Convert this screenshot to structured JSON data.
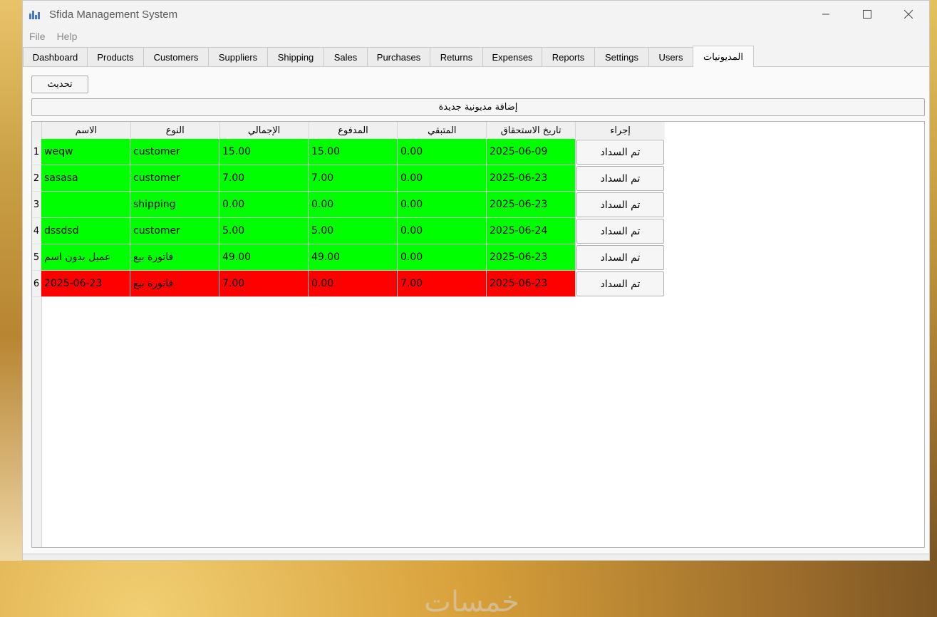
{
  "window": {
    "title": "Sfida Management System"
  },
  "menu": [
    "File",
    "Help"
  ],
  "tabs": [
    {
      "label": "Dashboard"
    },
    {
      "label": "Products"
    },
    {
      "label": "Customers"
    },
    {
      "label": "Suppliers"
    },
    {
      "label": "Shipping"
    },
    {
      "label": "Sales"
    },
    {
      "label": "Purchases"
    },
    {
      "label": "Returns"
    },
    {
      "label": "Expenses"
    },
    {
      "label": "Reports"
    },
    {
      "label": "Settings"
    },
    {
      "label": "Users"
    },
    {
      "label": "المديونيات",
      "active": true
    }
  ],
  "toolbar": {
    "refresh_label": "تحديث",
    "add_label": "إضافة مديونية جديدة"
  },
  "table": {
    "headers": [
      "الاسم",
      "النوع",
      "الإجمالي",
      "المدفوع",
      "المتبقي",
      "تاريخ الاستحقاق",
      "إجراء"
    ],
    "action_label": "تم السداد",
    "row_colors": {
      "paid": "#00ff00",
      "unpaid": "#ff0000"
    },
    "rows": [
      {
        "num": "1",
        "name": "weqw",
        "type": "customer",
        "total": "15.00",
        "paid": "15.00",
        "remaining": "0.00",
        "due": "2025-06-09",
        "status": "paid"
      },
      {
        "num": "2",
        "name": "sasasa",
        "type": "customer",
        "total": "7.00",
        "paid": "7.00",
        "remaining": "0.00",
        "due": "2025-06-23",
        "status": "paid"
      },
      {
        "num": "3",
        "name": "",
        "type": "shipping",
        "total": "0.00",
        "paid": "0.00",
        "remaining": "0.00",
        "due": "2025-06-23",
        "status": "paid"
      },
      {
        "num": "4",
        "name": "dssdsd",
        "type": "customer",
        "total": "5.00",
        "paid": "5.00",
        "remaining": "0.00",
        "due": "2025-06-24",
        "status": "paid"
      },
      {
        "num": "5",
        "name": "عميل بدون اسم",
        "type": "فاتورة بيع",
        "total": "49.00",
        "paid": "49.00",
        "remaining": "0.00",
        "due": "2025-06-23",
        "status": "paid"
      },
      {
        "num": "6",
        "name": "2025-06-23",
        "type": "فاتورة بيع",
        "total": "7.00",
        "paid": "0.00",
        "remaining": "7.00",
        "due": "2025-06-23",
        "status": "unpaid"
      }
    ]
  },
  "watermark": {
    "text": "خمسات"
  }
}
